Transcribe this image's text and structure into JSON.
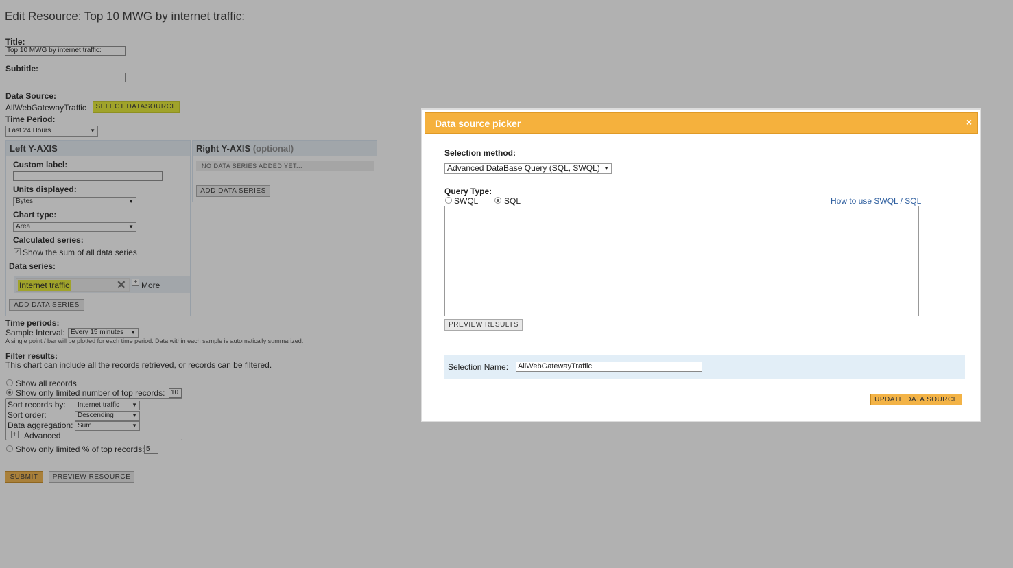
{
  "page": {
    "title": "Edit Resource: Top 10 MWG by internet traffic:",
    "title_label": "Title:",
    "title_value": "Top 10 MWG by internet traffic:",
    "subtitle_label": "Subtitle:",
    "subtitle_value": "",
    "datasource_label": "Data Source:",
    "datasource_value": "AllWebGatewayTraffic",
    "select_datasource_button": "SELECT DATASOURCE",
    "time_period_label": "Time Period:",
    "time_period_value": "Last 24 Hours"
  },
  "left_axis": {
    "title": "Left Y-AXIS",
    "custom_label_label": "Custom label:",
    "custom_label_value": "",
    "units_label": "Units displayed:",
    "units_value": "Bytes",
    "chart_type_label": "Chart type:",
    "chart_type_value": "Area",
    "calculated_label": "Calculated series:",
    "show_sum_label": "Show the sum of all data series",
    "show_sum_checked": true,
    "data_series_label": "Data series:",
    "series_item": "Internet traffic",
    "more_label": "More",
    "add_series_button": "ADD DATA SERIES"
  },
  "right_axis": {
    "title": "Right Y-AXIS",
    "optional": "(optional)",
    "empty_text": "NO DATA SERIES ADDED YET...",
    "add_series_button": "ADD DATA SERIES"
  },
  "time_periods": {
    "label": "Time periods:",
    "sample_interval_label": "Sample Interval:",
    "sample_interval_value": "Every 15 minutes",
    "note": "A single point / bar will be plotted for each time period. Data within each sample is automatically summarized."
  },
  "filter": {
    "label": "Filter results:",
    "description": "This chart can include all the records retrieved, or records can be filtered.",
    "show_all": "Show all records",
    "show_limited": "Show only limited number of top records:",
    "limited_value": "10",
    "sort_by_label": "Sort records by:",
    "sort_by_value": "Internet traffic",
    "sort_order_label": "Sort order:",
    "sort_order_value": "Descending",
    "aggregation_label": "Data aggregation:",
    "aggregation_value": "Sum",
    "advanced_label": "Advanced",
    "show_percent": "Show only limited % of top records:",
    "percent_value": "5"
  },
  "actions": {
    "submit": "SUBMIT",
    "preview": "PREVIEW RESOURCE"
  },
  "modal": {
    "title": "Data source picker",
    "close": "×",
    "selection_method_label": "Selection method:",
    "selection_method_value": "Advanced DataBase Query (SQL, SWQL)",
    "query_type_label": "Query Type:",
    "swql_label": "SWQL",
    "sql_label": "SQL",
    "query_type_selected": "SQL",
    "help_link": "How to use SWQL / SQL",
    "query_text": "",
    "preview_button": "PREVIEW RESULTS",
    "selection_name_label": "Selection Name:",
    "selection_name_value": "AllWebGatewayTraffic",
    "update_button": "UPDATE DATA SOURCE"
  },
  "colors": {
    "modal_header": "#f5b13d",
    "highlight": "#e5ea2c",
    "orange_button": "#f3b346",
    "overlay": "rgba(40,40,40,0.36)"
  }
}
